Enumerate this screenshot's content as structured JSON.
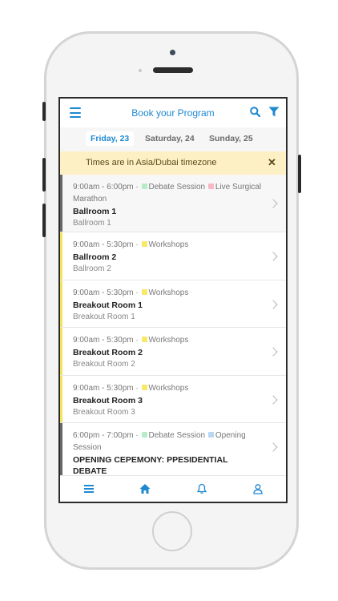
{
  "header": {
    "title": "Book your Program"
  },
  "day_tabs": [
    {
      "label": "Friday, 23",
      "active": true
    },
    {
      "label": "Saturday, 24",
      "active": false
    },
    {
      "label": "Sunday, 25",
      "active": false
    }
  ],
  "banner": {
    "text": "Times are in Asia/Dubai timezone",
    "close": "✕"
  },
  "colors": {
    "accent": "#1e88d0",
    "workshops": "#f7e96a",
    "debate_session": "#b7ecc9",
    "live_surgical": "#f7b7c3",
    "opening": "#b9d6f2",
    "yellow_bar": "#f2e35f",
    "gray_bar": "#666666"
  },
  "sessions": [
    {
      "time": "9:00am - 6:00pm ·",
      "tag1": "Debate Session",
      "tag2": "Live Surgical Marathon",
      "title": "Ballroom 1",
      "location": "Ballroom 1"
    },
    {
      "time": "9:00am - 5:30pm ·",
      "tag1": "Workshops",
      "title": "Ballroom 2",
      "location": "Ballroom 2"
    },
    {
      "time": "9:00am - 5:30pm ·",
      "tag1": "Workshops",
      "title": "Breakout Room 1",
      "location": "Breakout Room 1"
    },
    {
      "time": "9:00am - 5:30pm ·",
      "tag1": "Workshops",
      "title": "Breakout Room 2",
      "location": "Breakout Room 2"
    },
    {
      "time": "9:00am - 5:30pm ·",
      "tag1": "Workshops",
      "title": "Breakout Room 3",
      "location": "Breakout Room 3"
    },
    {
      "time": "6:00pm - 7:00pm ·",
      "tag1": "Debate Session",
      "tag2": "Opening Session",
      "title": "OPENING CEPEMONY: PPESIDENTIAL DEBATE"
    }
  ],
  "bottom_nav": [
    "list-icon",
    "home-icon",
    "bell-icon",
    "user-icon"
  ]
}
